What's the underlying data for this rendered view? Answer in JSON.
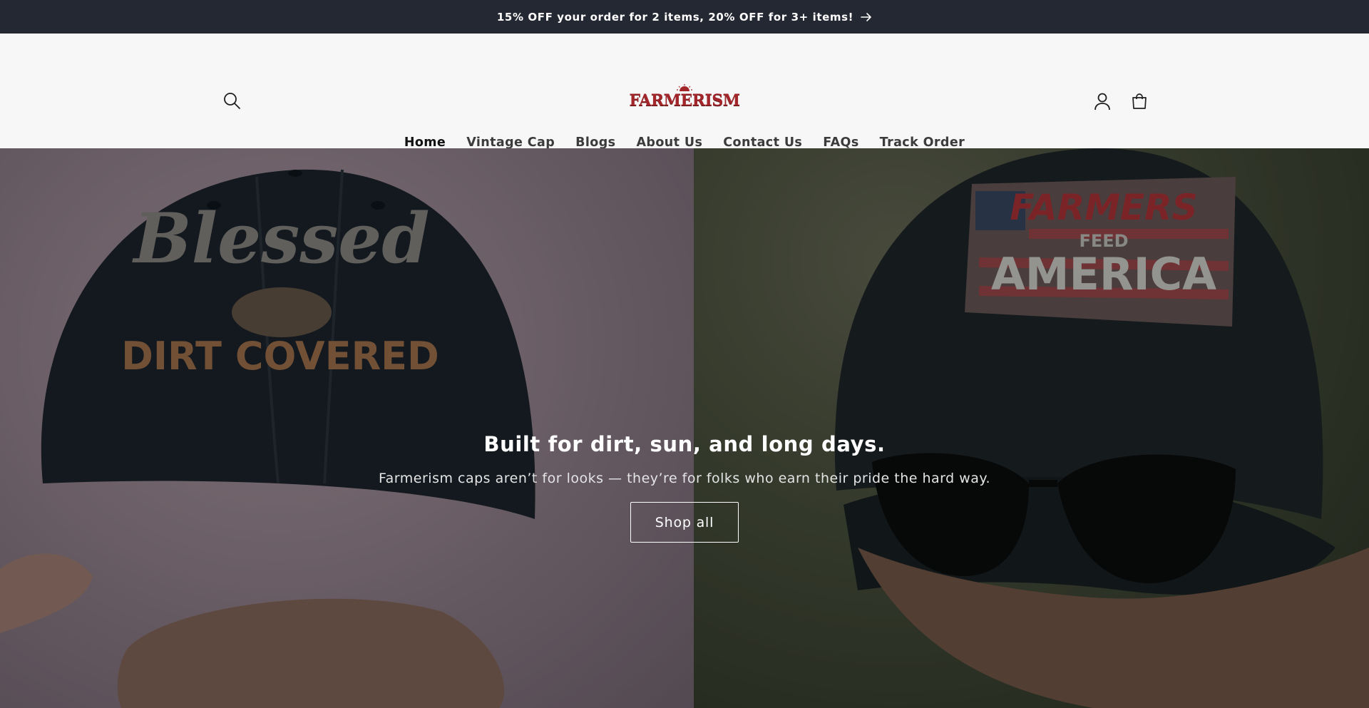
{
  "announcement": {
    "text": "15% OFF your order for 2 items, 20% OFF for 3+ items!",
    "icon": "arrow-right-icon"
  },
  "header": {
    "logo_text": "FARMERISM",
    "brand_color": "#a3262b",
    "icons": [
      "search-icon",
      "account-icon",
      "cart-icon"
    ]
  },
  "nav": {
    "items": [
      {
        "label": "Home",
        "active": true
      },
      {
        "label": "Vintage Cap"
      },
      {
        "label": "Blogs"
      },
      {
        "label": "About Us"
      },
      {
        "label": "Contact Us"
      },
      {
        "label": "FAQs"
      },
      {
        "label": "Track Order"
      }
    ]
  },
  "hero": {
    "title": "Built for dirt, sun, and long days.",
    "subtitle": "Farmerism caps aren’t for looks — they’re for folks who earn their pride the hard way.",
    "button_label": "Shop all",
    "left_image": {
      "cap_line1": "Blessed",
      "cap_line2": "DIRT COVERED"
    },
    "right_image": {
      "cap_line1": "FARMERS",
      "cap_line2": "FEED",
      "cap_line3": "AMERICA"
    }
  }
}
